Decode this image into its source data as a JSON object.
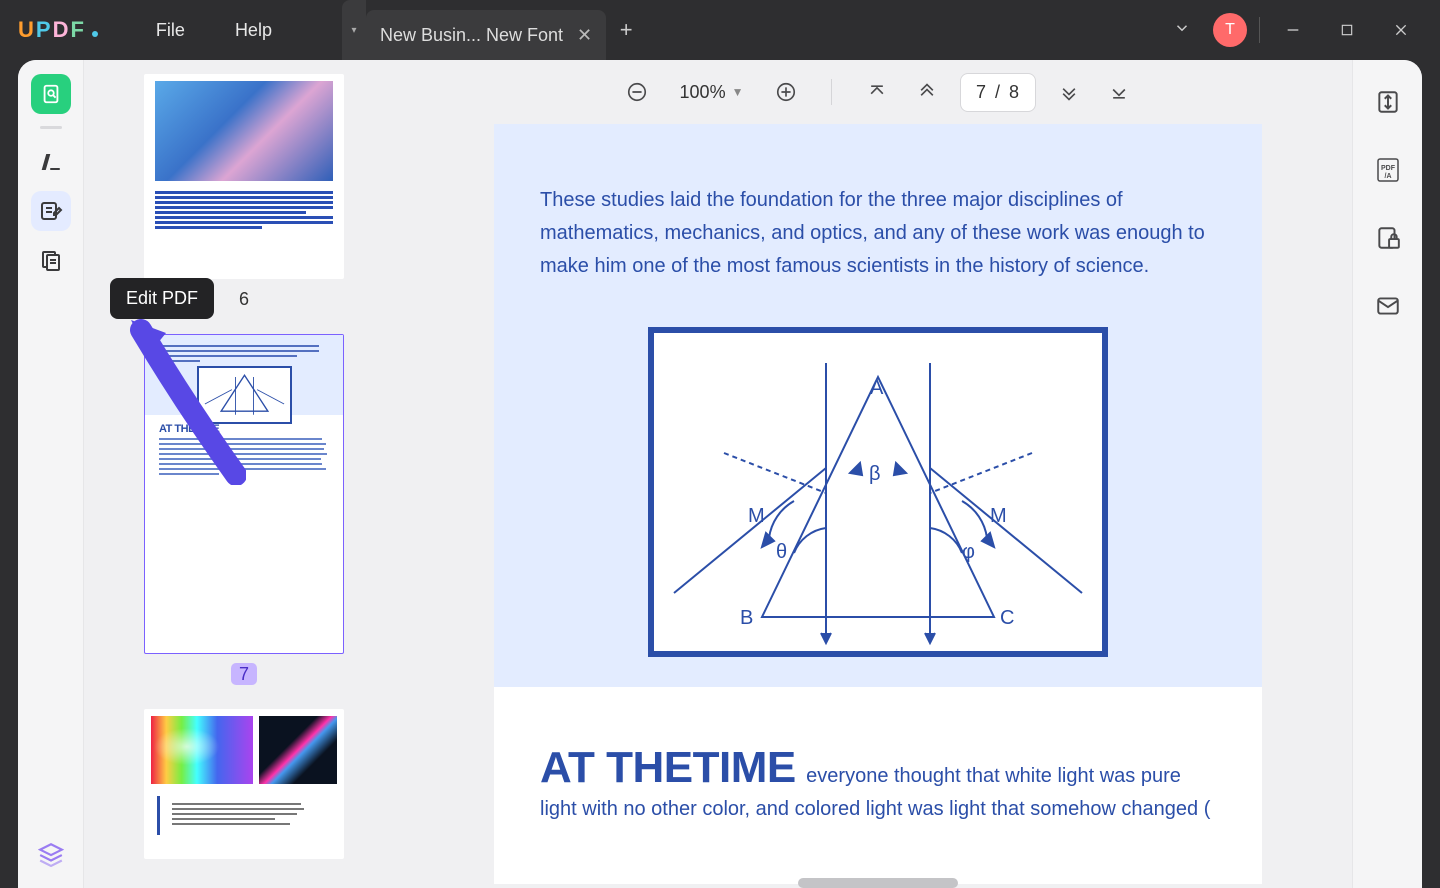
{
  "app": {
    "logo_letters": [
      "U",
      "P",
      "D",
      "F"
    ],
    "menu": {
      "file": "File",
      "help": "Help"
    },
    "tab": {
      "title": "New Busin... New Font",
      "close": "✕",
      "add": "+",
      "tri": "▾"
    },
    "avatar": "T"
  },
  "left_sidebar": {
    "tooltip": "Edit PDF"
  },
  "thumbs": {
    "p6": "6",
    "p7": "7",
    "p7_heading": "AT THETIME"
  },
  "toolbar": {
    "zoom": "100%",
    "page_display": "7 / 8"
  },
  "content": {
    "band_text": "These studies laid the foundation for the three major disciplines of mathematics, mechanics, and optics, and any of these work was enough to make him one of the most famous scientists in the history of science.",
    "diagram": {
      "A": "A",
      "B": "B",
      "C": "C",
      "M1": "M",
      "M2": "M",
      "beta": "β",
      "theta": "θ",
      "phi": "φ"
    },
    "heading": "AT THETIME",
    "body_after": "everyone thought that white light was pure light with no other color, and colored light was light that somehow changed ("
  },
  "colors": {
    "brand_blue": "#2b4ea8",
    "band_bg": "#e3ecff",
    "accent_purple": "#7b61ff",
    "arrow": "#5848e5"
  }
}
